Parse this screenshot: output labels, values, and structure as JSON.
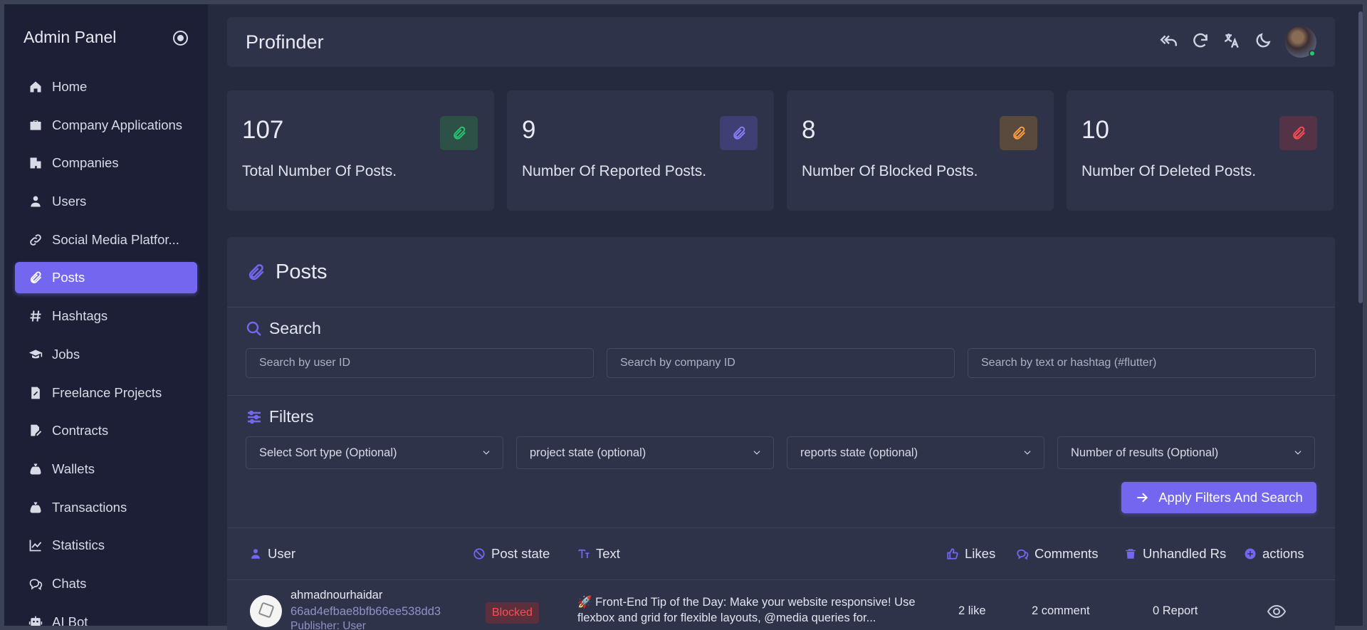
{
  "sidebar": {
    "title": "Admin Panel",
    "items": [
      {
        "label": "Home",
        "icon": "home-icon"
      },
      {
        "label": "Company Applications",
        "icon": "briefcase-icon"
      },
      {
        "label": "Companies",
        "icon": "building-icon"
      },
      {
        "label": "Users",
        "icon": "user-icon"
      },
      {
        "label": "Social Media Platfor...",
        "icon": "link-icon"
      },
      {
        "label": "Posts",
        "icon": "paperclip-icon",
        "active": true
      },
      {
        "label": "Hashtags",
        "icon": "hashtag-icon"
      },
      {
        "label": "Jobs",
        "icon": "graduation-cap-icon"
      },
      {
        "label": "Freelance Projects",
        "icon": "file-edit-icon"
      },
      {
        "label": "Contracts",
        "icon": "file-signature-icon"
      },
      {
        "label": "Wallets",
        "icon": "money-bag-icon"
      },
      {
        "label": "Transactions",
        "icon": "money-bag-icon"
      },
      {
        "label": "Statistics",
        "icon": "chart-line-icon"
      },
      {
        "label": "Chats",
        "icon": "chat-icon"
      },
      {
        "label": "AI Bot",
        "icon": "robot-icon"
      }
    ]
  },
  "header": {
    "title": "Profinder",
    "icons": [
      "reply-all-icon",
      "refresh-icon",
      "translate-icon",
      "moon-icon"
    ]
  },
  "stats": [
    {
      "value": "107",
      "label": "Total Number Of Posts.",
      "color": "#28c76f",
      "bg": "#2e5147"
    },
    {
      "value": "9",
      "label": "Number Of Reported Posts.",
      "color": "#7367f0",
      "bg": "#3e3f72"
    },
    {
      "value": "8",
      "label": "Number Of Blocked Posts.",
      "color": "#ff9f43",
      "bg": "#5a4a3d"
    },
    {
      "value": "10",
      "label": "Number Of Deleted Posts.",
      "color": "#ff4c51",
      "bg": "#553346"
    }
  ],
  "posts": {
    "title": "Posts",
    "search": {
      "title": "Search",
      "user_placeholder": "Search by user ID",
      "company_placeholder": "Search by company ID",
      "text_placeholder": "Search by text or hashtag (#flutter)"
    },
    "filters": {
      "title": "Filters",
      "sort": "Select Sort type (Optional)",
      "project_state": "project state (optional)",
      "reports_state": "reports state (optional)",
      "results": "Number of results (Optional)",
      "apply": "Apply Filters And Search"
    },
    "table": {
      "headers": {
        "user": "User",
        "post_state": "Post state",
        "text": "Text",
        "likes": "Likes",
        "comments": "Comments",
        "unhandled": "Unhandled Rs",
        "actions": "actions"
      },
      "rows": [
        {
          "name": "ahmadnourhaidar",
          "id": "66ad4efbae8bfb66ee538dd3",
          "publisher": "Publisher: User",
          "state": "Blocked",
          "text": "🚀 Front-End Tip of the Day: Make your website responsive! Use flexbox and grid for flexible layouts, @media queries for...",
          "likes": "2 like",
          "comments": "2 comment",
          "reports": "0 Report"
        }
      ]
    }
  },
  "colors": {
    "accent": "#7367f0",
    "sidebar_bg": "#1c1f35",
    "card_bg": "#2f3349",
    "page_bg": "#252a3e"
  }
}
